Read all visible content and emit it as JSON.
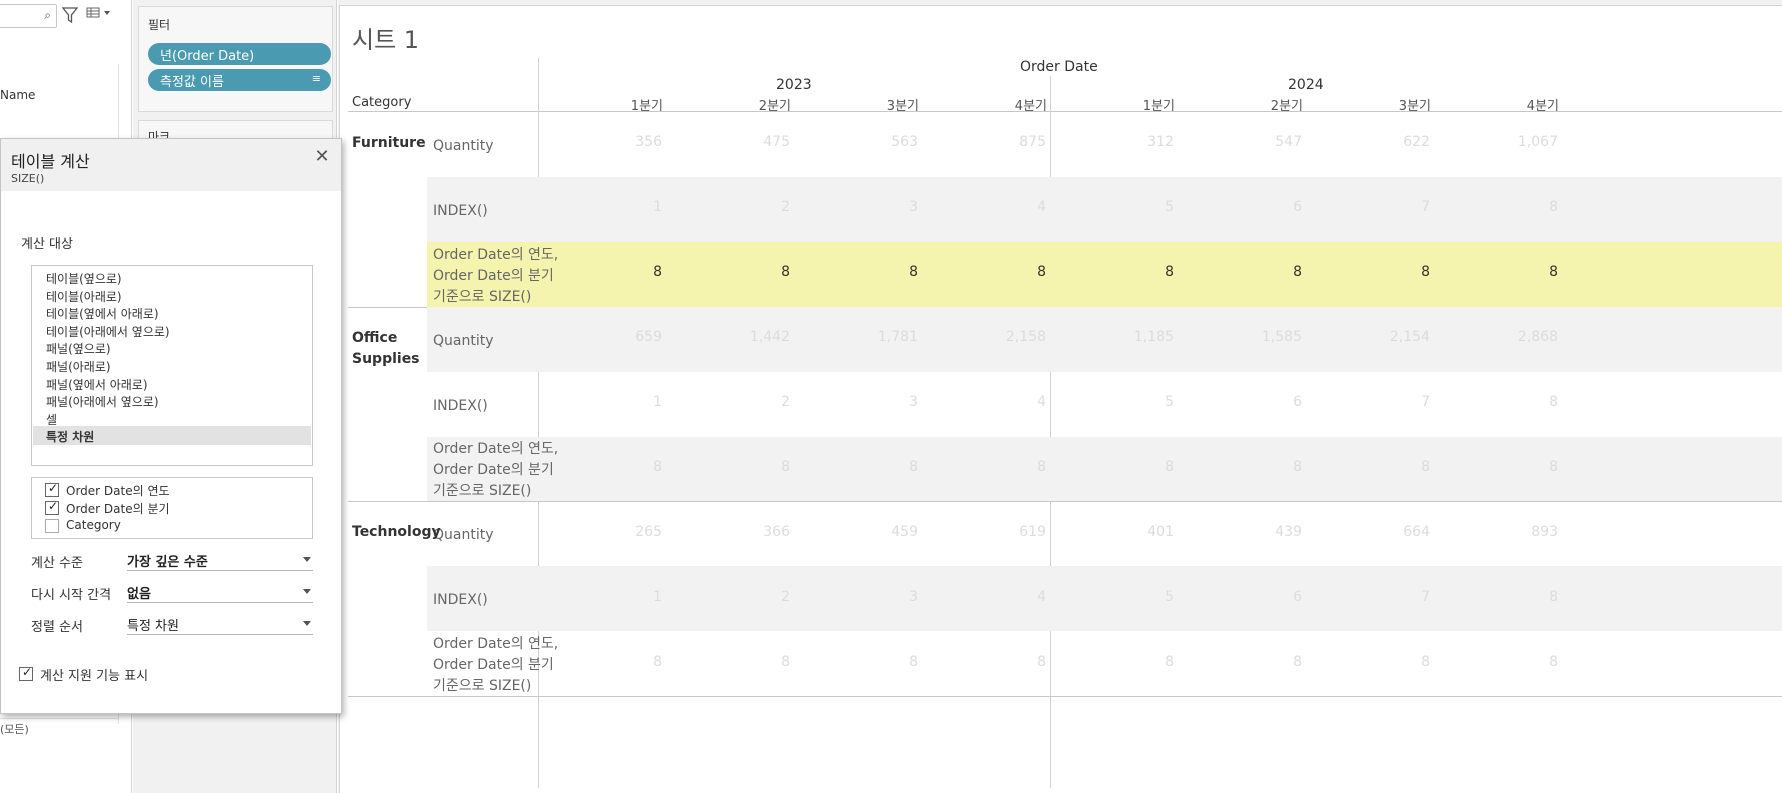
{
  "left_pane": {
    "search_placeholder": "",
    "filter_icon": "filter-icon",
    "view_icon": "grid-view-icon",
    "name_label": "Name",
    "bottom_text": "(모든)"
  },
  "shelves": {
    "filter_title": "필터",
    "filter_pills": [
      "년(Order Date)",
      "측정값 이름"
    ],
    "marks_title": "마크"
  },
  "dialog": {
    "title": "테이블 계산",
    "subtitle": "SIZE()",
    "close_glyph": "✕",
    "compute_label": "계산 대상",
    "compute_options": [
      "테이블(옆으로)",
      "테이블(아래로)",
      "테이블(옆에서 아래로)",
      "테이블(아래에서 옆으로)",
      "패널(옆으로)",
      "패널(아래로)",
      "패널(옆에서 아래로)",
      "패널(아래에서 옆으로)",
      "셀",
      "특정 차원"
    ],
    "compute_selected": "특정 차원",
    "dimensions": [
      {
        "label": "Order Date의 연도",
        "checked": true
      },
      {
        "label": "Order Date의 분기",
        "checked": true
      },
      {
        "label": "Category",
        "checked": false
      }
    ],
    "level_label": "계산 수준",
    "level_value": "가장 깊은 수준",
    "restart_label": "다시 시작 간격",
    "restart_value": "없음",
    "sort_label": "정렬 순서",
    "sort_value": "특정 차원",
    "assist_label": "계산 지원 기능 표시",
    "assist_checked": true,
    "check_glyph": "✓"
  },
  "sheet": {
    "title": "시트 1",
    "column_header": "Order Date",
    "row_header": "Category",
    "years": [
      "2023",
      "2024"
    ],
    "quarters": [
      "1분기",
      "2분기",
      "3분기",
      "4분기",
      "1분기",
      "2분기",
      "3분기",
      "4분기"
    ],
    "categories": [
      {
        "name_lines": [
          "Furniture"
        ],
        "rows": [
          {
            "measure_lines": [
              "Quantity"
            ],
            "values": [
              "356",
              "475",
              "563",
              "875",
              "312",
              "547",
              "622",
              "1,067"
            ]
          },
          {
            "measure_lines": [
              "INDEX()"
            ],
            "values": [
              "1",
              "2",
              "3",
              "4",
              "5",
              "6",
              "7",
              "8"
            ]
          },
          {
            "measure_lines": [
              "Order Date의 연도,",
              "Order Date의 분기",
              "기준으로 SIZE()"
            ],
            "values": [
              "8",
              "8",
              "8",
              "8",
              "8",
              "8",
              "8",
              "8"
            ]
          }
        ]
      },
      {
        "name_lines": [
          "Office",
          "Supplies"
        ],
        "rows": [
          {
            "measure_lines": [
              "Quantity"
            ],
            "values": [
              "659",
              "1,442",
              "1,781",
              "2,158",
              "1,185",
              "1,585",
              "2,154",
              "2,868"
            ]
          },
          {
            "measure_lines": [
              "INDEX()"
            ],
            "values": [
              "1",
              "2",
              "3",
              "4",
              "5",
              "6",
              "7",
              "8"
            ]
          },
          {
            "measure_lines": [
              "Order Date의 연도,",
              "Order Date의 분기",
              "기준으로 SIZE()"
            ],
            "values": [
              "8",
              "8",
              "8",
              "8",
              "8",
              "8",
              "8",
              "8"
            ]
          }
        ]
      },
      {
        "name_lines": [
          "Technology"
        ],
        "rows": [
          {
            "measure_lines": [
              "Quantity"
            ],
            "values": [
              "265",
              "366",
              "459",
              "619",
              "401",
              "439",
              "664",
              "893"
            ]
          },
          {
            "measure_lines": [
              "INDEX()"
            ],
            "values": [
              "1",
              "2",
              "3",
              "4",
              "5",
              "6",
              "7",
              "8"
            ]
          },
          {
            "measure_lines": [
              "Order Date의 연도,",
              "Order Date의 분기",
              "기준으로 SIZE()"
            ],
            "values": [
              "8",
              "8",
              "8",
              "8",
              "8",
              "8",
              "8",
              "8"
            ]
          }
        ]
      }
    ],
    "colors": {
      "highlight_row": "#f4f4ae",
      "band_gray": "#f2f2f2",
      "faded_value": "#dcdcdc",
      "strong_value": "#333333",
      "pill": "#4a9bb2"
    }
  }
}
